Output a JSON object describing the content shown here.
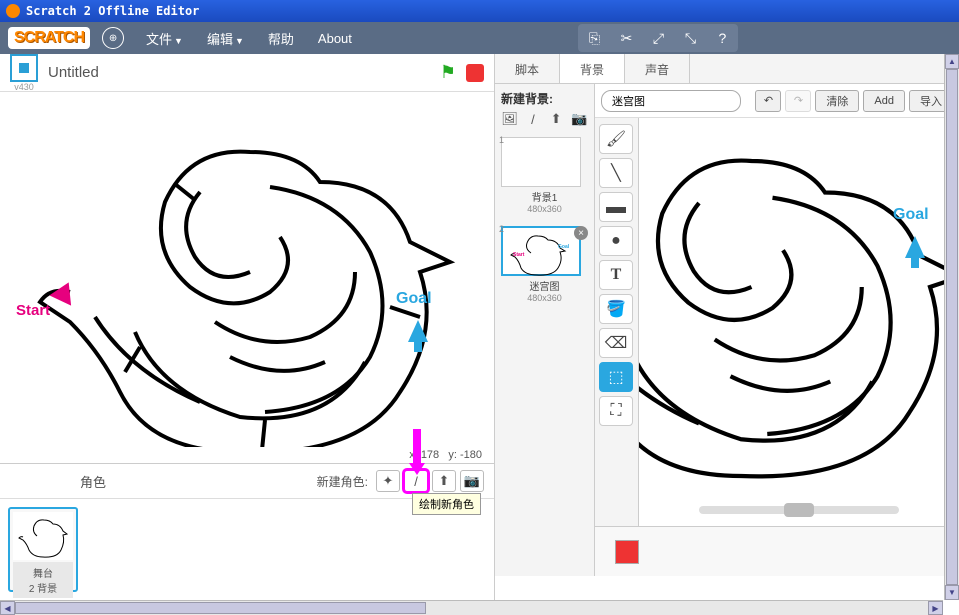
{
  "window": {
    "title": "Scratch 2 Offline Editor"
  },
  "logo": "SCRATCH",
  "menu": {
    "file": "文件",
    "edit": "编辑",
    "help": "帮助",
    "about": "About"
  },
  "stage": {
    "title": "Untitled",
    "version": "v430",
    "coords_x_label": "x:",
    "coords_x": "178",
    "coords_y_label": "y:",
    "coords_y": "-180",
    "start_label": "Start",
    "goal_label": "Goal"
  },
  "sprites": {
    "label": "角色",
    "new_label": "新建角色:",
    "tooltip": "绘制新角色",
    "stage_thumb": {
      "name": "舞台",
      "sub": "2 背景"
    }
  },
  "tabs": {
    "scripts": "脚本",
    "backdrops": "背景",
    "sounds": "声音"
  },
  "backdrops": {
    "new_label": "新建背景:",
    "items": [
      {
        "num": "1",
        "name": "背景1",
        "size": "480x360"
      },
      {
        "num": "2",
        "name": "迷宫图",
        "size": "480x360"
      }
    ]
  },
  "editor": {
    "name_value": "迷宫图",
    "clear": "清除",
    "add": "Add",
    "import": "导入"
  }
}
